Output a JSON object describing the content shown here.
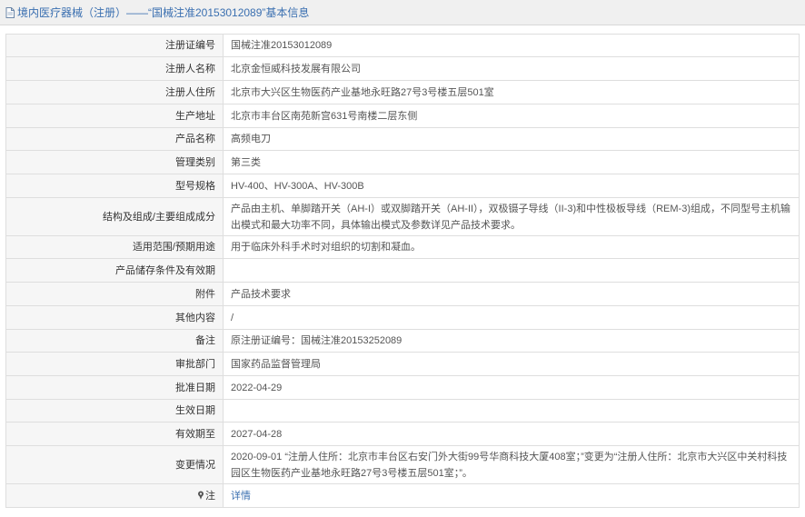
{
  "header": {
    "title": "境内医疗器械（注册）——“国械注准20153012089”基本信息",
    "title_color": "#3a6fb0"
  },
  "rows": [
    {
      "label": "注册证编号",
      "value": "国械注准20153012089"
    },
    {
      "label": "注册人名称",
      "value": "北京金恒威科技发展有限公司"
    },
    {
      "label": "注册人住所",
      "value": "北京市大兴区生物医药产业基地永旺路27号3号楼五层501室"
    },
    {
      "label": "生产地址",
      "value": "北京市丰台区南苑新宫631号南楼二层东侧"
    },
    {
      "label": "产品名称",
      "value": "高频电刀"
    },
    {
      "label": "管理类别",
      "value": "第三类"
    },
    {
      "label": "型号规格",
      "value": "HV-400、HV-300A、HV-300B"
    },
    {
      "label": "结构及组成/主要组成成分",
      "value": "产品由主机、单脚踏开关（AH-I）或双脚踏开关（AH-II），双极镊子导线（II-3)和中性极板导线（REM-3)组成，不同型号主机输出模式和最大功率不同，具体输出模式及参数详见产品技术要求。"
    },
    {
      "label": "适用范围/预期用途",
      "value": "用于临床外科手术时对组织的切割和凝血。"
    },
    {
      "label": "产品储存条件及有效期",
      "value": ""
    },
    {
      "label": "附件",
      "value": "产品技术要求"
    },
    {
      "label": "其他内容",
      "value": "/"
    },
    {
      "label": "备注",
      "value": "原注册证编号：国械注准20153252089"
    },
    {
      "label": "审批部门",
      "value": "国家药品监督管理局"
    },
    {
      "label": "批准日期",
      "value": "2022-04-29"
    },
    {
      "label": "生效日期",
      "value": ""
    },
    {
      "label": "有效期至",
      "value": "2027-04-28"
    },
    {
      "label": "变更情况",
      "value": "2020-09-01 “注册人住所：北京市丰台区右安门外大街99号华商科技大厦408室；”变更为“注册人住所：北京市大兴区中关村科技园区生物医药产业基地永旺路27号3号楼五层501室；”。"
    }
  ],
  "note": {
    "label": "注",
    "link_text": "详情",
    "icon": "pin-icon"
  },
  "icons": {
    "header": "document-icon"
  },
  "colors": {
    "link": "#3a6fb0",
    "label_bg": "#f6f6f6",
    "border": "#dedede",
    "header_bg": "#f0f0f0"
  }
}
